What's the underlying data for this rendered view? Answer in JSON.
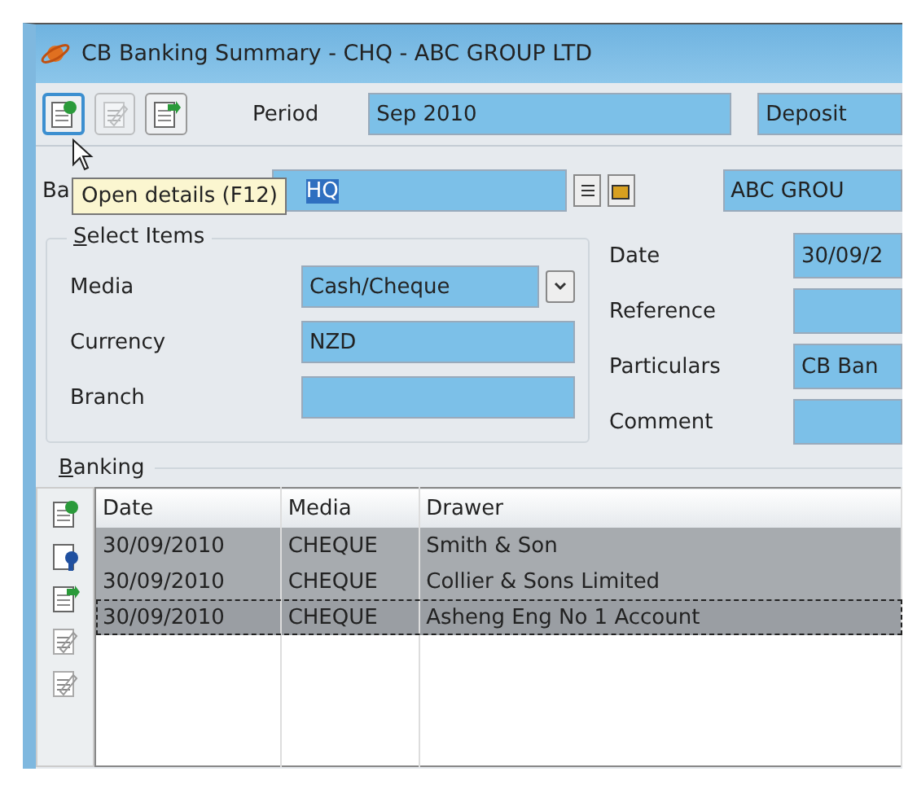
{
  "window": {
    "title": "CB Banking Summary - CHQ - ABC GROUP LTD"
  },
  "toolbar": {
    "buttons": [
      {
        "kind": "open",
        "highlighted": true,
        "disabled": false
      },
      {
        "kind": "edit",
        "highlighted": false,
        "disabled": true
      },
      {
        "kind": "add",
        "highlighted": false,
        "disabled": false
      }
    ],
    "period_label": "Period",
    "period_value": "Sep 2010",
    "type_value": "Deposit"
  },
  "tooltip": "Open details (F12)",
  "bank": {
    "label": "Ba",
    "value": "HQ",
    "name_value": "ABC GROU"
  },
  "select_items": {
    "title": "Select Items",
    "fields": [
      {
        "label": "Media",
        "value": "Cash/Cheque",
        "kind": "dropdown"
      },
      {
        "label": "Currency",
        "value": "NZD",
        "kind": "text"
      },
      {
        "label": "Branch",
        "kind": "text"
      }
    ]
  },
  "details": [
    {
      "label": "Date",
      "value": "30/09/2"
    },
    {
      "label": "Reference"
    },
    {
      "label": "Particulars",
      "value": "CB Ban"
    },
    {
      "label": "Comment"
    }
  ],
  "banking": {
    "title": "Banking",
    "columns": [
      "Date",
      "Media",
      "Drawer"
    ],
    "rows": [
      {
        "cells": [
          "30/09/2010",
          "CHEQUE",
          "Smith & Son"
        ],
        "selected": true,
        "focused": false
      },
      {
        "cells": [
          "30/09/2010",
          "CHEQUE",
          "Collier & Sons Limited"
        ],
        "selected": true,
        "focused": false
      },
      {
        "cells": [
          "30/09/2010",
          "CHEQUE",
          "Asheng Eng No 1 Account"
        ],
        "selected": true,
        "focused": true
      }
    ]
  }
}
